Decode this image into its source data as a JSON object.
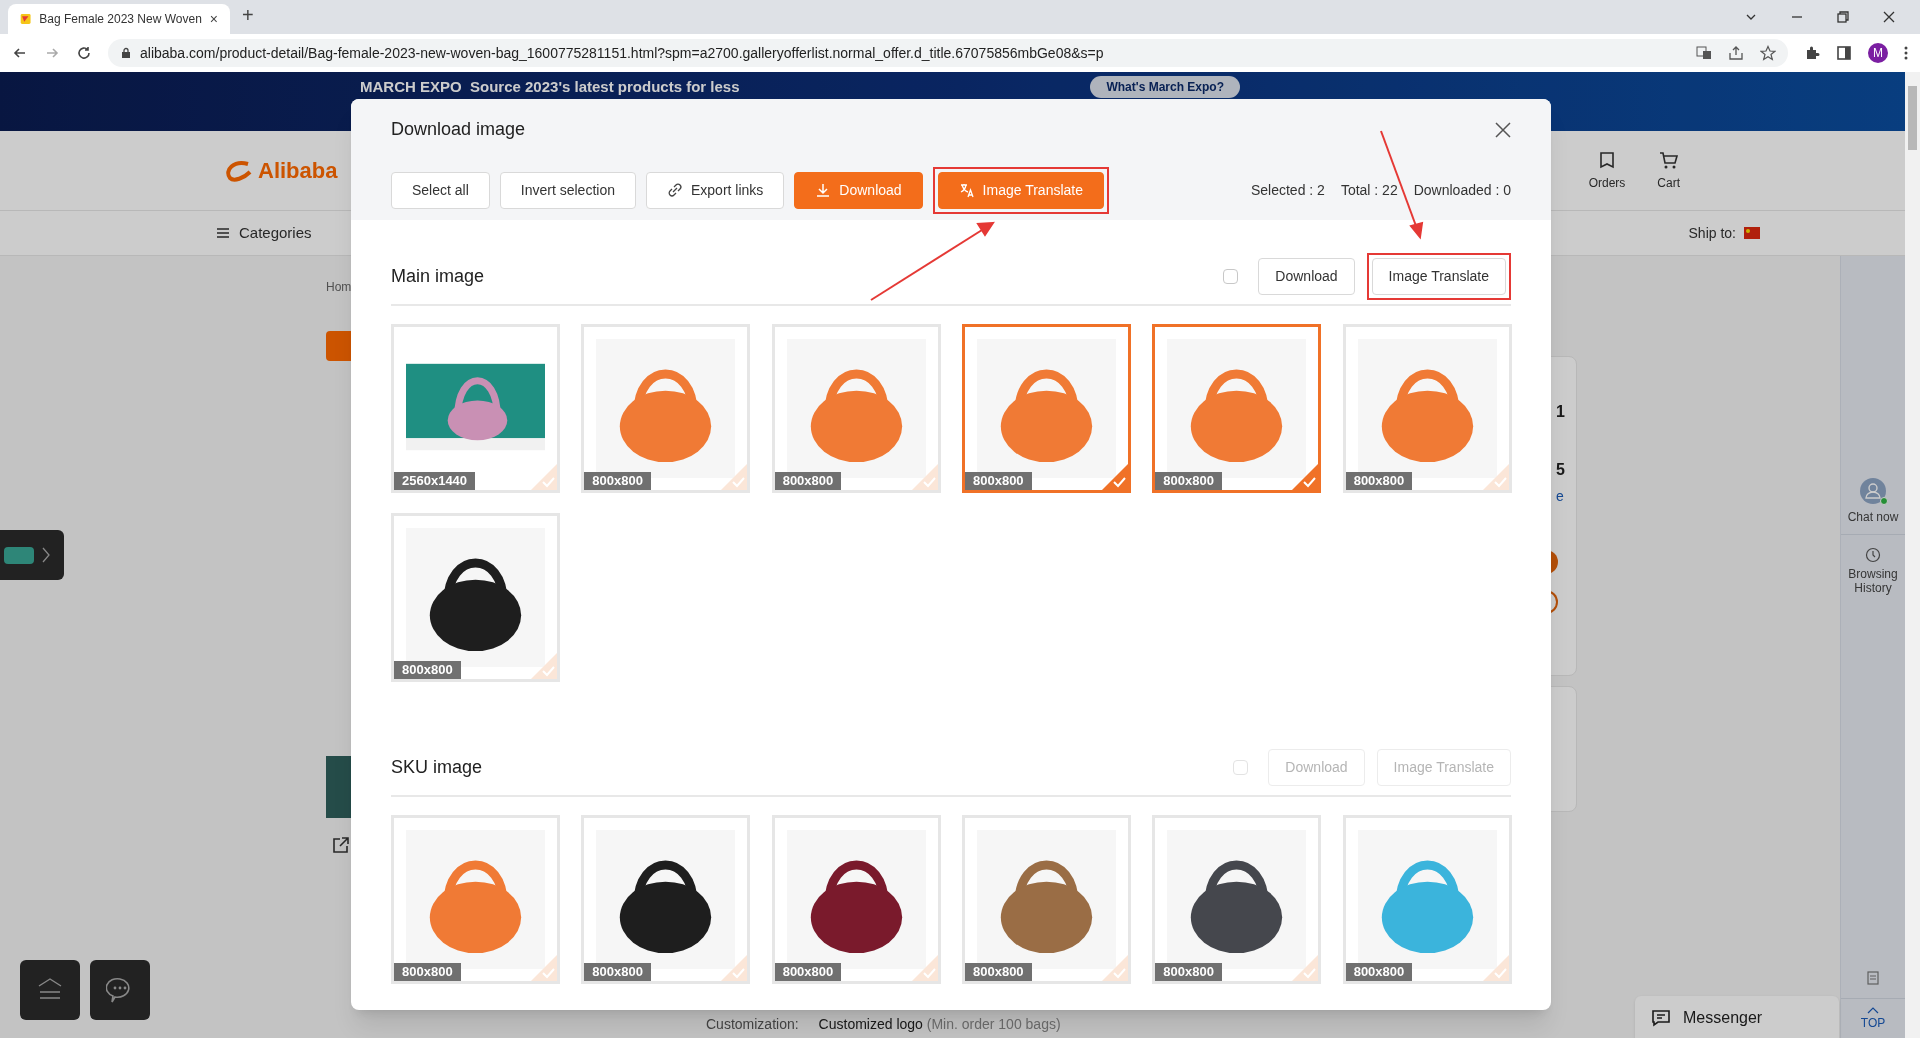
{
  "browser": {
    "tab_title": "Bag Female 2023 New Woven",
    "tab_close": "×",
    "new_tab": "+",
    "url": "alibaba.com/product-detail/Bag-female-2023-new-woven-bag_1600775281151.html?spm=a2700.galleryofferlist.normal_offer.d_title.67075856mbGe08&s=p",
    "profile": "M"
  },
  "page": {
    "banner_text": "MARCH EXPO  Source 2023's latest products for less",
    "banner_button": "What's March Expo?",
    "logo": "Alibaba",
    "header_links": [
      "Orders",
      "Cart"
    ],
    "categories": "Categories",
    "ship_to": "Ship to:",
    "breadcrumb": "Hom",
    "fragments": [
      "1",
      "5",
      "e"
    ],
    "side_rail": [
      "Chat now",
      "Browsing History"
    ],
    "customization_label": "Customization:",
    "customization_value": "Customized logo",
    "customization_note": "(Min. order 100 bags)",
    "messenger": "Messenger",
    "top": "TOP"
  },
  "dialog": {
    "title": "Download image",
    "toolbar": [
      {
        "label": "Select all",
        "kind": "plain",
        "highlighted": false
      },
      {
        "label": "Invert selection",
        "kind": "plain",
        "highlighted": false
      },
      {
        "label": "Export links",
        "kind": "link",
        "highlighted": false
      },
      {
        "label": "Download",
        "kind": "download",
        "highlighted": false
      },
      {
        "label": "Image Translate",
        "kind": "translate",
        "highlighted": true
      }
    ],
    "stats": [
      "Selected : 2",
      "Total : 22",
      "Downloaded : 0"
    ],
    "sections": [
      {
        "title": "Main image",
        "checked": false,
        "disabled": false,
        "actions": [
          {
            "label": "Download",
            "highlighted": false
          },
          {
            "label": "Image Translate",
            "highlighted": true
          }
        ],
        "images": [
          {
            "size": "2560x1440",
            "selected": false,
            "kind": "scene",
            "color": "#c990b4"
          },
          {
            "size": "800x800",
            "selected": false,
            "kind": "product",
            "color": "#f07a35"
          },
          {
            "size": "800x800",
            "selected": false,
            "kind": "product",
            "color": "#f07a35"
          },
          {
            "size": "800x800",
            "selected": true,
            "kind": "product",
            "color": "#f07a35"
          },
          {
            "size": "800x800",
            "selected": true,
            "kind": "product",
            "color": "#f07a35"
          },
          {
            "size": "800x800",
            "selected": false,
            "kind": "product",
            "color": "#f07a35"
          },
          {
            "size": "800x800",
            "selected": false,
            "kind": "product",
            "color": "#1e1e1e"
          }
        ]
      },
      {
        "title": "SKU image",
        "checked": false,
        "disabled": true,
        "actions": [
          {
            "label": "Download",
            "highlighted": false
          },
          {
            "label": "Image Translate",
            "highlighted": false
          }
        ],
        "images": [
          {
            "size": "800x800",
            "selected": false,
            "kind": "product",
            "color": "#f07a35"
          },
          {
            "size": "800x800",
            "selected": false,
            "kind": "product",
            "color": "#1e1e1e"
          },
          {
            "size": "800x800",
            "selected": false,
            "kind": "product",
            "color": "#7a1a2c"
          },
          {
            "size": "800x800",
            "selected": false,
            "kind": "product",
            "color": "#9a6d45"
          },
          {
            "size": "800x800",
            "selected": false,
            "kind": "product",
            "color": "#45474d"
          },
          {
            "size": "800x800",
            "selected": false,
            "kind": "product",
            "color": "#3bb4dc"
          }
        ]
      }
    ]
  }
}
